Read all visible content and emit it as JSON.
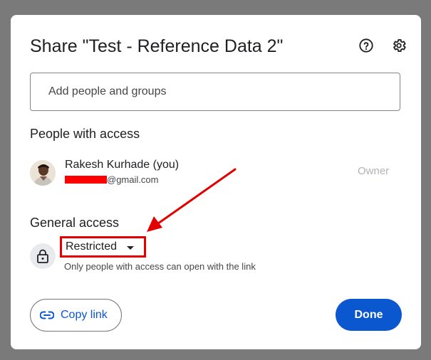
{
  "dialog": {
    "title": "Share \"Test - Reference Data 2\"",
    "help_icon": "help-circle-icon",
    "settings_icon": "gear-icon"
  },
  "add_people": {
    "placeholder": "Add people and groups",
    "value": ""
  },
  "people_section": {
    "title": "People with access",
    "users": [
      {
        "name": "Rakesh Kurhade (you)",
        "email_suffix": "@gmail.com",
        "role": "Owner"
      }
    ]
  },
  "general_access": {
    "title": "General access",
    "selected": "Restricted",
    "description": "Only people with access can open with the link",
    "icon": "lock-icon"
  },
  "footer": {
    "copy_link_label": "Copy link",
    "copy_link_icon": "link-icon",
    "done_label": "Done"
  },
  "colors": {
    "primary": "#0b57d0",
    "annotation": "#e30000",
    "backdrop": "#7a7a7a"
  }
}
